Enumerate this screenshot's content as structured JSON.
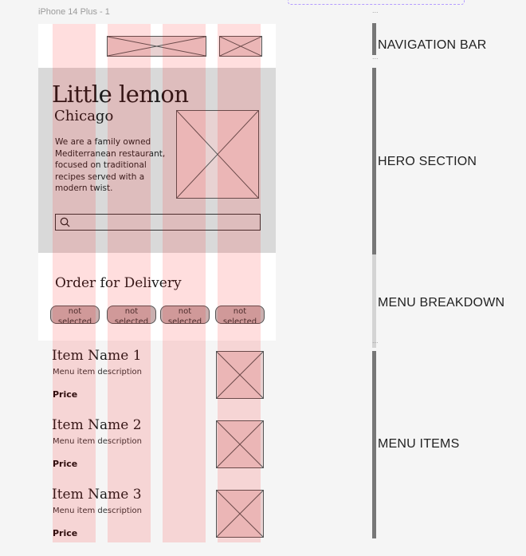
{
  "canvas": {
    "frame_title": "iPhone 14 Plus - 1",
    "dots": "..."
  },
  "hero": {
    "title": "Little lemon",
    "city": "Chicago",
    "description": "We are a family owned Mediterranean restaurant, focused on traditional recipes served with a modern twist."
  },
  "order": {
    "title": "Order for Delivery",
    "chips": [
      "not selected",
      "not selected",
      "not selected",
      "not selected"
    ]
  },
  "menu_items": [
    {
      "name": "Item Name 1",
      "description": "Menu item description",
      "price": "Price"
    },
    {
      "name": "Item Name 2",
      "description": "Menu item description",
      "price": "Price"
    },
    {
      "name": "Item Name 3",
      "description": "Menu item description",
      "price": "Price"
    }
  ],
  "section_labels": {
    "navigation": "NAVIGATION BAR",
    "hero": "HERO SECTION",
    "menu_breakdown": "MENU BREAKDOWN",
    "menu_items": "MENU ITEMS"
  },
  "icons": {
    "search": "search-icon",
    "image_placeholder": "image-placeholder-icon"
  },
  "colors": {
    "hero_background": "#d9d9d9",
    "layout_grid": "#ff0000",
    "canvas": "#f5f5f5",
    "selection": "#b59cff"
  }
}
